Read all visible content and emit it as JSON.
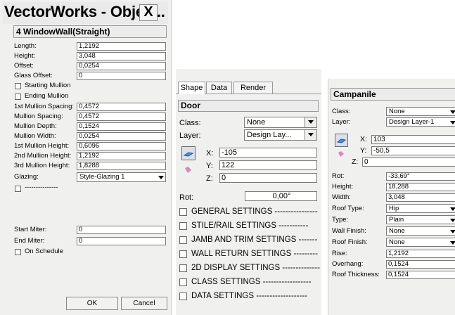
{
  "panel1": {
    "title": "VectorWorks - Objec...",
    "close_glyph": "X",
    "object_header": "4 WindowWall(Straight)",
    "fields": [
      {
        "label": "Length:",
        "value": "1,2192"
      },
      {
        "label": "Height:",
        "value": "3,048"
      },
      {
        "label": "Offset:",
        "value": "0,0254"
      },
      {
        "label": "Glass Offset:",
        "value": "0"
      }
    ],
    "checkboxes": [
      "Starting Mullion",
      "Ending Mullion"
    ],
    "fields2": [
      {
        "label": "1st Mullion Spacing:",
        "value": "0,4572"
      },
      {
        "label": "Mullion Spacing:",
        "value": "0,4572"
      },
      {
        "label": "Mullion Depth:",
        "value": "0,1524"
      },
      {
        "label": "Mullion Width:",
        "value": "0,0254"
      },
      {
        "label": "1st Mullion Height:",
        "value": "0,6096"
      },
      {
        "label": "2nd Mullion Height:",
        "value": "1,2192"
      },
      {
        "label": "3rd Mullion Height:",
        "value": "1,8288"
      }
    ],
    "glazing": {
      "label": "Glazing:",
      "value": "Style-Glazing 1"
    },
    "divider_checkbox_label": "---------------",
    "fields3": [
      {
        "label": "Start Miter:",
        "value": "0"
      },
      {
        "label": "End Miter:",
        "value": "0"
      }
    ],
    "schedule_label": "On Schedule",
    "ok_label": "OK",
    "cancel_label": "Cancel"
  },
  "panel2": {
    "tabs": [
      "Shape",
      "Data",
      "Render"
    ],
    "object_header": "Door",
    "class": {
      "label": "Class:",
      "value": "None"
    },
    "layer": {
      "label": "Layer:",
      "value": "Design Lay..."
    },
    "x": {
      "label": "X:",
      "value": "-105"
    },
    "y": {
      "label": "Y:",
      "value": "122"
    },
    "z": {
      "label": "Z:",
      "value": "0"
    },
    "rot": {
      "label": "Rot:",
      "value": "0,00°"
    },
    "settings": [
      "GENERAL SETTINGS ----------------",
      "STILE/RAIL SETTINGS -----------",
      "JAMB AND TRIM SETTINGS -------",
      "WALL RETURN SETTINGS ---------",
      "2D DISPLAY SETTINGS --------------",
      "CLASS SETTINGS ------------------",
      "DATA SETTINGS -------------------"
    ]
  },
  "panel3": {
    "object_header": "Campanile",
    "class": {
      "label": "Class:",
      "value": "None"
    },
    "layer": {
      "label": "Layer:",
      "value": "Design Layer-1"
    },
    "x": {
      "label": "X:",
      "value": "103"
    },
    "y": {
      "label": "Y:",
      "value": "-50,5"
    },
    "z": {
      "label": "Z:",
      "value": "0"
    },
    "fields": [
      {
        "label": "Rot:",
        "value": "-33,69°"
      },
      {
        "label": "Height:",
        "value": "18,288"
      },
      {
        "label": "Width:",
        "value": "3,048"
      }
    ],
    "selects": [
      {
        "label": "Roof Type:",
        "value": "Hip"
      },
      {
        "label": "Type:",
        "value": "Plain"
      },
      {
        "label": "Wall Finish:",
        "value": "None"
      },
      {
        "label": "Roof Finish:",
        "value": "None"
      }
    ],
    "fields2": [
      {
        "label": "Rise:",
        "value": "1,2192"
      },
      {
        "label": "Overhang:",
        "value": "0,1524"
      },
      {
        "label": "Roof Thickness:",
        "value": "0,1524"
      }
    ]
  }
}
